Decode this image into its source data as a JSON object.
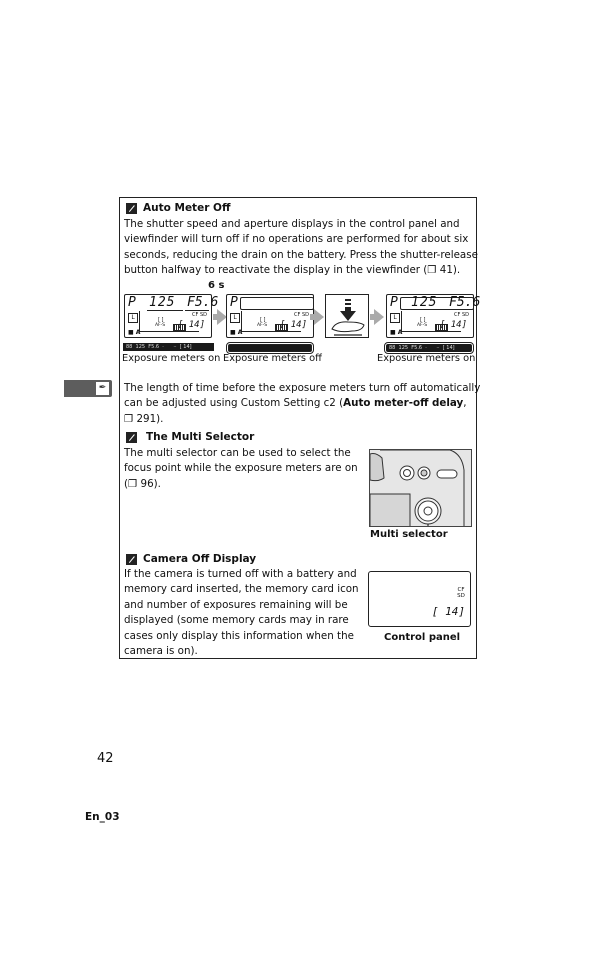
{
  "section_tab": {
    "icon": "custom-settings-pencil-icon"
  },
  "auto_meter_off": {
    "heading": "Auto Meter Off",
    "body_lines": [
      "The shutter speed and aperture displays in the control panel and",
      "viewfinder will turn off if no operations are performed for about six",
      "seconds, reducing the drain on the battery.  Press the shutter-release",
      "button halfway to reactivate the display in the viewfinder (❐ 41)."
    ],
    "timer_label": "6 s",
    "panels": [
      {
        "state": "on",
        "mode": "P",
        "shutter": "125",
        "aperture": "F5.6",
        "count": "[ 14]",
        "card": "CF SD",
        "caption": "Exposure meters on",
        "viewfinder_text": "88  125  F5.6  ·      ··  [ 14]"
      },
      {
        "state": "off",
        "mode": "P",
        "shutter": "",
        "aperture": "",
        "count": "[ 14]",
        "card": "CF SD",
        "caption": "Exposure meters off",
        "viewfinder_text": ""
      },
      {
        "state": "on",
        "mode": "P",
        "shutter": "125",
        "aperture": "F5.6",
        "count": "[ 14]",
        "card": "CF SD",
        "caption": "Exposure meters on",
        "viewfinder_text": "88  125  F5.6  ·      ··  [ 14]"
      }
    ],
    "followup_lines": [
      "The length of time before the exposure meters turn off automatically",
      "can be adjusted using Custom Setting c2 ("
    ],
    "followup_bold": "Auto meter-off delay",
    "followup_tail": ",",
    "followup_ref": "❐ 291)."
  },
  "multi_selector": {
    "heading": "The Multi Selector",
    "body_lines": [
      "The multi selector can be used to select the",
      "focus point while the exposure meters are on",
      "(❐ 96)."
    ],
    "image_caption": "Multi selector"
  },
  "camera_off_display": {
    "heading": "Camera Off Display",
    "body_lines": [
      "If the camera is turned off with a battery and",
      "memory card inserted, the memory card icon",
      "and number of exposures remaining will be",
      "displayed (some memory cards may in rare",
      "cases only display this information when the",
      "camera is on)."
    ],
    "panel_card": "CF SD",
    "panel_count": "[ 14]",
    "image_caption": "Control panel"
  },
  "footer": {
    "page_number": "42",
    "code": "En_03"
  }
}
